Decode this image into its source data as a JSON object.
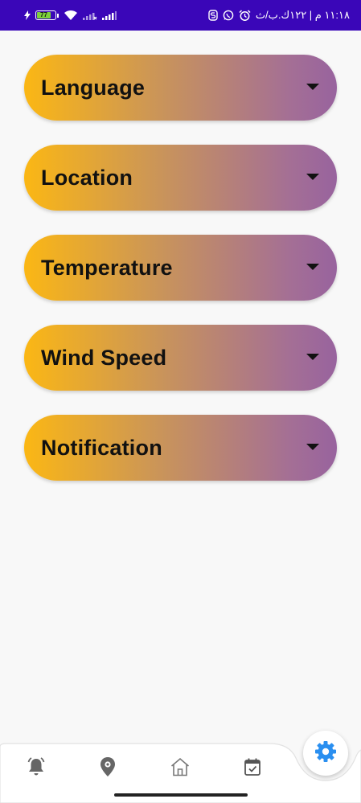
{
  "status_bar": {
    "battery_level": "77",
    "time_text": "١١:١٨ م | ١٢٢ك.ب/ث"
  },
  "settings": [
    {
      "label": "Language"
    },
    {
      "label": "Location"
    },
    {
      "label": "Temperature"
    },
    {
      "label": "Wind Speed"
    },
    {
      "label": "Notification"
    }
  ],
  "bottom_nav": {
    "items": [
      {
        "icon": "alarm-bell-icon"
      },
      {
        "icon": "map-pin-icon"
      },
      {
        "icon": "home-icon"
      },
      {
        "icon": "calendar-check-icon"
      }
    ],
    "active": {
      "icon": "gear-icon",
      "color": "#2a8ff0"
    }
  },
  "colors": {
    "status_bar": "#3a06b8",
    "gradient_start": "#fbb714",
    "gradient_end": "#98639e"
  }
}
